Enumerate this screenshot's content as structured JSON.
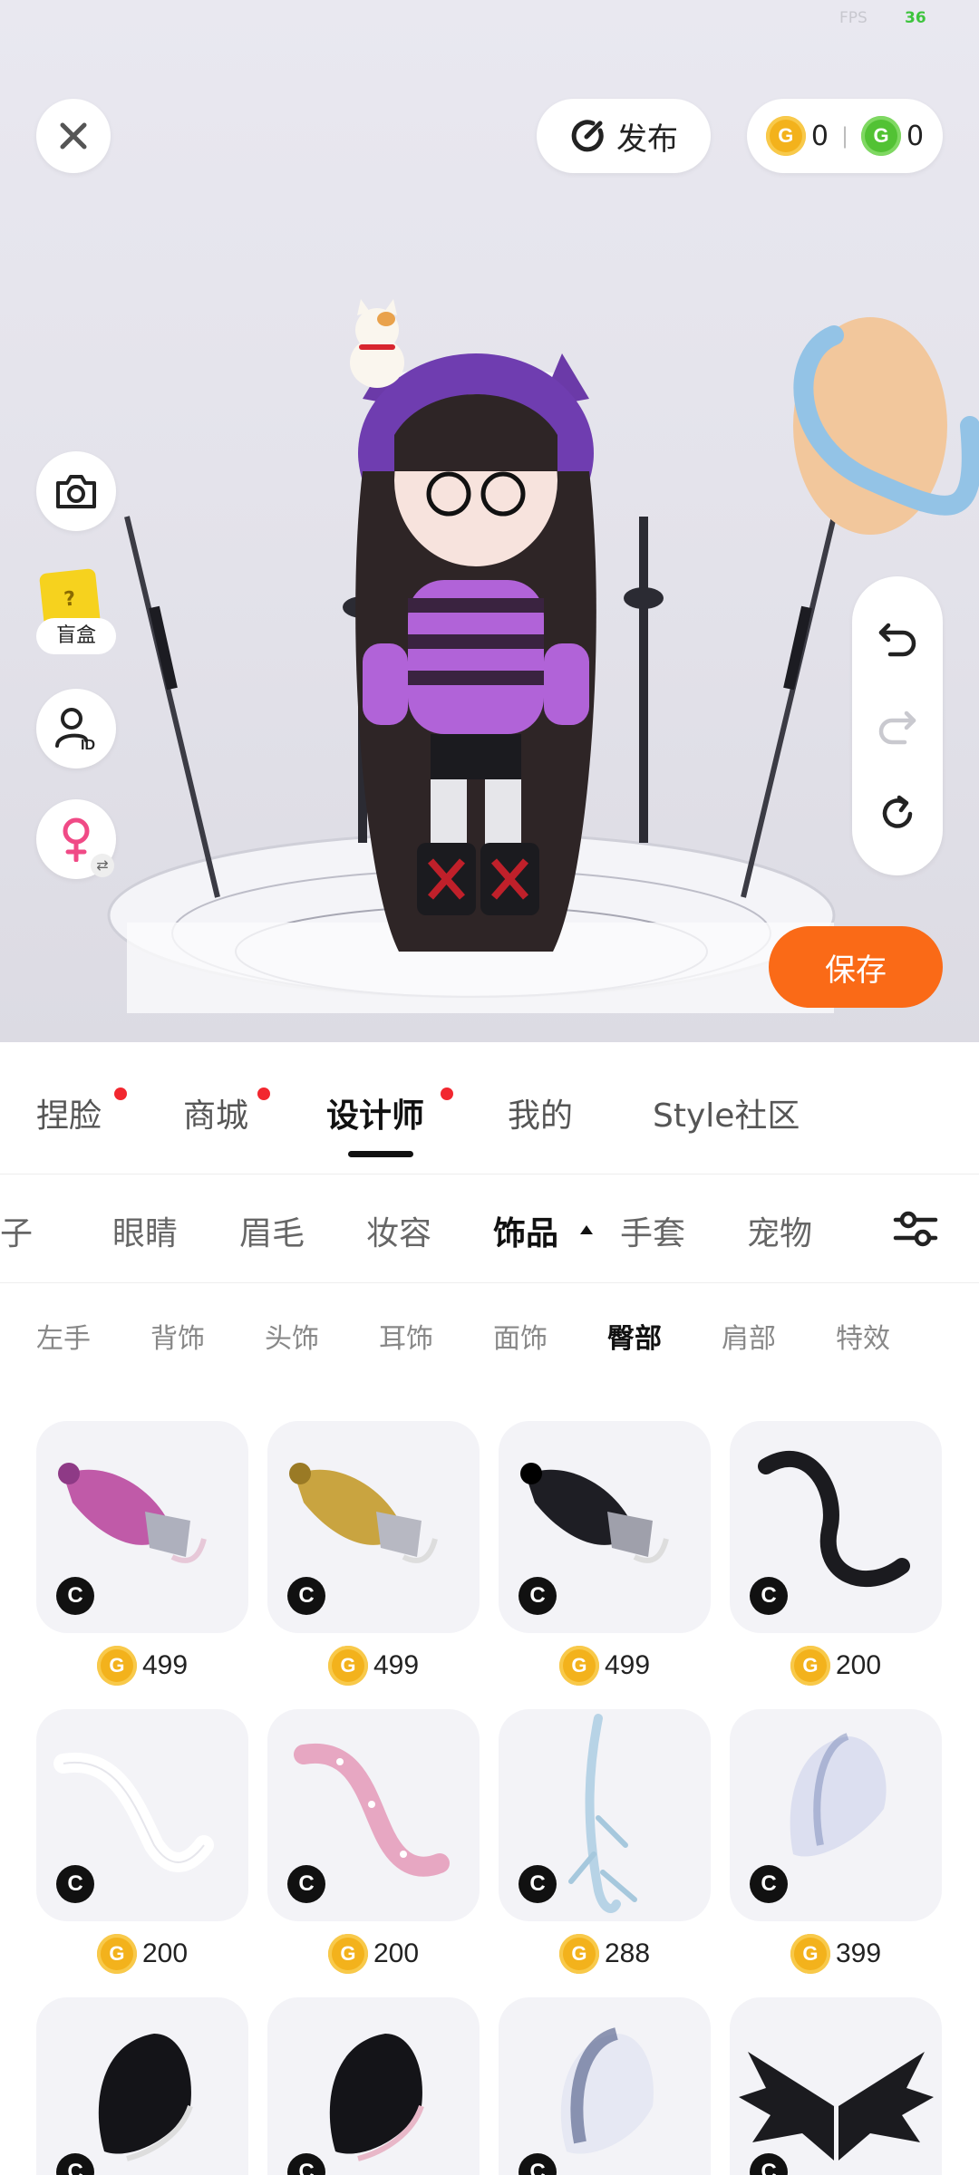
{
  "status": {
    "fps_label": "FPS",
    "fps_value": "36"
  },
  "header": {
    "publish_label": "发布",
    "gold_coins": "0",
    "green_coins": "0",
    "coin_letter": "G"
  },
  "left_tools": {
    "blind_box_label": "盲盒",
    "blind_box_mark": "?"
  },
  "actions": {
    "save_label": "保存"
  },
  "main_tabs": [
    {
      "label": "捏脸",
      "dot": true
    },
    {
      "label": "商城",
      "dot": true
    },
    {
      "label": "设计师",
      "dot": true,
      "active": true
    },
    {
      "label": "我的",
      "dot": false
    },
    {
      "label": "Style社区",
      "dot": false
    }
  ],
  "category_tabs": [
    {
      "label": "鞋子"
    },
    {
      "label": "眼睛"
    },
    {
      "label": "眉毛"
    },
    {
      "label": "妆容"
    },
    {
      "label": "饰品",
      "active": true
    },
    {
      "label": "手套"
    },
    {
      "label": "宠物"
    }
  ],
  "sub_tabs": [
    {
      "label": "左手"
    },
    {
      "label": "背饰"
    },
    {
      "label": "头饰"
    },
    {
      "label": "耳饰"
    },
    {
      "label": "面饰"
    },
    {
      "label": "臀部",
      "active": true
    },
    {
      "label": "肩部"
    },
    {
      "label": "特效"
    }
  ],
  "items": [
    {
      "price": "499",
      "icon": "pink-tail-icon"
    },
    {
      "price": "499",
      "icon": "gold-tail-icon"
    },
    {
      "price": "499",
      "icon": "black-tail-icon"
    },
    {
      "price": "200",
      "icon": "black-cat-tail-icon"
    },
    {
      "price": "200",
      "icon": "white-cat-tail-icon"
    },
    {
      "price": "200",
      "icon": "pink-spotted-tail-icon"
    },
    {
      "price": "288",
      "icon": "crystal-tail-icon"
    },
    {
      "price": "399",
      "icon": "fluffy-white-tail-icon"
    },
    {
      "price": "",
      "icon": "black-fluffy-tail-icon"
    },
    {
      "price": "",
      "icon": "black-pink-tail-icon"
    },
    {
      "price": "",
      "icon": "blue-fluffy-tail-icon"
    },
    {
      "price": "",
      "icon": "black-wings-icon"
    }
  ],
  "badge_letter": "C",
  "colors": {
    "accent": "#fa6a17",
    "gold": "#f3b21c",
    "green": "#52c234",
    "red_dot": "#f2272f"
  }
}
